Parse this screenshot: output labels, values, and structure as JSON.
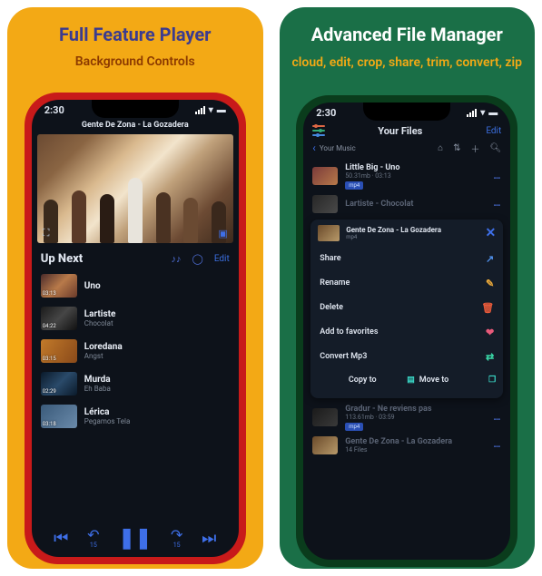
{
  "left": {
    "headline": "Full Feature Player",
    "subline": "Background Controls",
    "status_time": "2:30",
    "now_playing": "Gente De Zona - La Gozadera",
    "up_next_label": "Up Next",
    "edit": "Edit",
    "tracks": [
      {
        "time": "03:13",
        "title": "Uno",
        "sub": "",
        "bg": "linear-gradient(135deg,#4a2a2a,#b87a4a,#6a3a2a)"
      },
      {
        "time": "04:22",
        "title": "Lartiste",
        "sub": "Chocolat",
        "bg": "linear-gradient(135deg,#1a1a1a,#464646,#101010)"
      },
      {
        "time": "03:15",
        "title": "Loredana",
        "sub": "Angst",
        "bg": "linear-gradient(120deg,#c27a2a,#8a4a1a)"
      },
      {
        "time": "02:29",
        "title": "Murda",
        "sub": "Eh Baba",
        "bg": "linear-gradient(135deg,#0a1a2a,#2a4a6a,#0a1a2a)"
      },
      {
        "time": "03:18",
        "title": "Lérica",
        "sub": "Pegamos Tela",
        "bg": "linear-gradient(135deg,#3a5a7a,#6a8aaa)"
      }
    ],
    "skip_back": "15",
    "skip_fwd": "15"
  },
  "right": {
    "headline": "Advanced File Manager",
    "subline": "cloud, edit, crop, share, trim, convert, zip",
    "status_time": "2:30",
    "header_title": "Your Files",
    "edit": "Edit",
    "breadcrumb": "Your Music",
    "files_top": [
      {
        "title": "Little Big - Uno",
        "meta": "50.31mb · 03:13",
        "badge": "mp4",
        "bg": "linear-gradient(135deg,#7a3a3a,#b87a4a)"
      },
      {
        "title": "Lartiste - Chocolat",
        "meta": "",
        "badge": "",
        "bg": "linear-gradient(135deg,#262626,#4a4a4a)"
      }
    ],
    "context": {
      "title": "Gente De Zona - La Gozadera",
      "sub": "mp4",
      "rows": [
        {
          "label": "Share",
          "icon": "↗",
          "color": "#4f8fe8"
        },
        {
          "label": "Rename",
          "icon": "✎",
          "color": "#e8a73a"
        },
        {
          "label": "Delete",
          "icon": "🗑",
          "color": "#e85a3a"
        },
        {
          "label": "Add to favorites",
          "icon": "❤",
          "color": "#e85a7a"
        },
        {
          "label": "Convert Mp3",
          "icon": "⇄",
          "color": "#3ad8a7"
        }
      ],
      "copy_to": "Copy to",
      "move_to": "Move to"
    },
    "files_bottom": [
      {
        "title": "Gradur - Ne reviens pas",
        "meta": "113.61mb · 03:59",
        "badge": "mp4",
        "bg": "linear-gradient(135deg,#1a1a1a,#3a3a3a)"
      },
      {
        "title": "Gente De Zona - La Gozadera",
        "meta": "14 Files",
        "badge": "",
        "bg": "linear-gradient(135deg,#6a4a2a,#b89a6a)"
      }
    ]
  }
}
